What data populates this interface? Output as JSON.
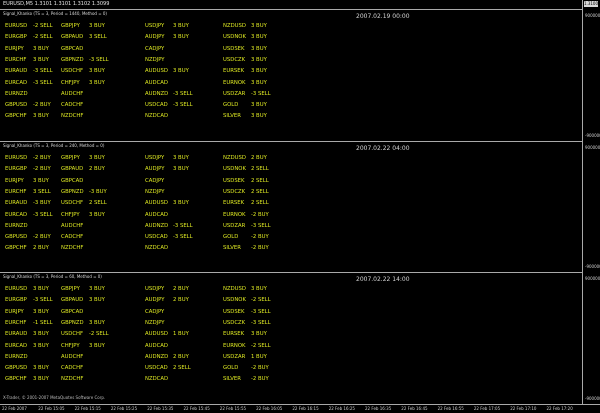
{
  "header": {
    "symbol_line": "EURUSD,M5  1.3101 1.3101 1.3102 1.3099",
    "price_box": "1.3100"
  },
  "panels": [
    {
      "title": "Signal_Khanko (TS = 3, Period = 1440, Method = 0)",
      "time": "2007.02.19 00:00",
      "scale_top": "90000000",
      "scale_bottom": "-90000000",
      "columns": [
        [
          {
            "sym": "EURUSD",
            "sig": "-2 SELL"
          },
          {
            "sym": "EURGBP",
            "sig": "-2 SELL"
          },
          {
            "sym": "EURJPY",
            "sig": "3 BUY"
          },
          {
            "sym": "EURCHF",
            "sig": "3 BUY"
          },
          {
            "sym": "EURAUD",
            "sig": "-3 SELL"
          },
          {
            "sym": "EURCAD",
            "sig": "-3 SELL"
          },
          {
            "sym": "EURNZD",
            "sig": ""
          },
          {
            "sym": "GBPUSD",
            "sig": "-2 BUY"
          },
          {
            "sym": "GBPCHF",
            "sig": "3 BUY"
          }
        ],
        [
          {
            "sym": "GBPJPY",
            "sig": "3 BUY"
          },
          {
            "sym": "GBPAUD",
            "sig": "3 SELL"
          },
          {
            "sym": "GBPCAD",
            "sig": ""
          },
          {
            "sym": "GBPNZD",
            "sig": "-3 SELL"
          },
          {
            "sym": "USDCHF",
            "sig": "3 BUY"
          },
          {
            "sym": "CHFJPY",
            "sig": "3 BUY"
          },
          {
            "sym": "AUDCHF",
            "sig": ""
          },
          {
            "sym": "CADCHF",
            "sig": ""
          },
          {
            "sym": "NZDCHF",
            "sig": ""
          }
        ],
        [
          {
            "sym": "USDJPY",
            "sig": "3 BUY"
          },
          {
            "sym": "AUDJPY",
            "sig": "3 BUY"
          },
          {
            "sym": "CADJPY",
            "sig": ""
          },
          {
            "sym": "NZDJPY",
            "sig": ""
          },
          {
            "sym": "AUDUSD",
            "sig": "3 BUY"
          },
          {
            "sym": "AUDCAD",
            "sig": ""
          },
          {
            "sym": "AUDNZD",
            "sig": "-3 SELL"
          },
          {
            "sym": "USDCAD",
            "sig": "-3 SELL"
          },
          {
            "sym": "NZDCAD",
            "sig": ""
          }
        ],
        [
          {
            "sym": "NZDUSD",
            "sig": "3 BUY"
          },
          {
            "sym": "USDNOK",
            "sig": "3 BUY"
          },
          {
            "sym": "USDSEK",
            "sig": "3 BUY"
          },
          {
            "sym": "USDCZK",
            "sig": "3 BUY"
          },
          {
            "sym": "EURSEK",
            "sig": "3 BUY"
          },
          {
            "sym": "EURNOK",
            "sig": "3 BUY"
          },
          {
            "sym": "USDZAR",
            "sig": "-3 SELL"
          },
          {
            "sym": "GOLD",
            "sig": "3 BUY"
          },
          {
            "sym": "SILVER",
            "sig": "3 BUY"
          }
        ]
      ]
    },
    {
      "title": "Signal_Khanko (TS = 3, Period = 240, Method = 0)",
      "time": "2007.02.22 04:00",
      "scale_top": "90000000",
      "scale_bottom": "-90000000",
      "columns": [
        [
          {
            "sym": "EURUSD",
            "sig": "-2 BUY"
          },
          {
            "sym": "EURGBP",
            "sig": "-2 BUY"
          },
          {
            "sym": "EURJPY",
            "sig": "3 BUY"
          },
          {
            "sym": "EURCHF",
            "sig": "3 SELL"
          },
          {
            "sym": "EURAUD",
            "sig": "-3 BUY"
          },
          {
            "sym": "EURCAD",
            "sig": "-3 SELL"
          },
          {
            "sym": "EURNZD",
            "sig": ""
          },
          {
            "sym": "GBPUSD",
            "sig": "-2 BUY"
          },
          {
            "sym": "GBPCHF",
            "sig": "2 BUY"
          }
        ],
        [
          {
            "sym": "GBPJPY",
            "sig": "3 BUY"
          },
          {
            "sym": "GBPAUD",
            "sig": "2 BUY"
          },
          {
            "sym": "GBPCAD",
            "sig": ""
          },
          {
            "sym": "GBPNZD",
            "sig": "-3 BUY"
          },
          {
            "sym": "USDCHF",
            "sig": "2 SELL"
          },
          {
            "sym": "CHFJPY",
            "sig": "3 BUY"
          },
          {
            "sym": "AUDCHF",
            "sig": ""
          },
          {
            "sym": "CADCHF",
            "sig": ""
          },
          {
            "sym": "NZDCHF",
            "sig": ""
          }
        ],
        [
          {
            "sym": "USDJPY",
            "sig": "3 BUY"
          },
          {
            "sym": "AUDJPY",
            "sig": "3 BUY"
          },
          {
            "sym": "CADJPY",
            "sig": ""
          },
          {
            "sym": "NZDJPY",
            "sig": ""
          },
          {
            "sym": "AUDUSD",
            "sig": "3 BUY"
          },
          {
            "sym": "AUDCAD",
            "sig": ""
          },
          {
            "sym": "AUDNZD",
            "sig": "-3 SELL"
          },
          {
            "sym": "USDCAD",
            "sig": "-3 SELL"
          },
          {
            "sym": "NZDCAD",
            "sig": ""
          }
        ],
        [
          {
            "sym": "NZDUSD",
            "sig": "2 BUY"
          },
          {
            "sym": "USDNOK",
            "sig": "2 SELL"
          },
          {
            "sym": "USDSEK",
            "sig": "2 SELL"
          },
          {
            "sym": "USDCZK",
            "sig": "2 SELL"
          },
          {
            "sym": "EURSEK",
            "sig": "2 SELL"
          },
          {
            "sym": "EURNOK",
            "sig": "-2 BUY"
          },
          {
            "sym": "USDZAR",
            "sig": "-3 SELL"
          },
          {
            "sym": "GOLD",
            "sig": "-2 BUY"
          },
          {
            "sym": "SILVER",
            "sig": "-2 BUY"
          }
        ]
      ]
    },
    {
      "title": "Signal_Khanko (TS = 3, Period = 60, Method = 0)",
      "time": "2007.02.22 14:00",
      "scale_top": "90000000",
      "scale_bottom": "-90000000",
      "columns": [
        [
          {
            "sym": "EURUSD",
            "sig": "3 BUY"
          },
          {
            "sym": "EURGBP",
            "sig": "-3 SELL"
          },
          {
            "sym": "EURJPY",
            "sig": "3 BUY"
          },
          {
            "sym": "EURCHF",
            "sig": "-1 SELL"
          },
          {
            "sym": "EURAUD",
            "sig": "3 BUY"
          },
          {
            "sym": "EURCAD",
            "sig": "3 BUY"
          },
          {
            "sym": "EURNZD",
            "sig": ""
          },
          {
            "sym": "GBPUSD",
            "sig": "3 BUY"
          },
          {
            "sym": "GBPCHF",
            "sig": "3 BUY"
          }
        ],
        [
          {
            "sym": "GBPJPY",
            "sig": "3 BUY"
          },
          {
            "sym": "GBPAUD",
            "sig": "3 BUY"
          },
          {
            "sym": "GBPCAD",
            "sig": ""
          },
          {
            "sym": "GBPNZD",
            "sig": "3 BUY"
          },
          {
            "sym": "USDCHF",
            "sig": "-2 SELL"
          },
          {
            "sym": "CHFJPY",
            "sig": "3 BUY"
          },
          {
            "sym": "AUDCHF",
            "sig": ""
          },
          {
            "sym": "CADCHF",
            "sig": ""
          },
          {
            "sym": "NZDCHF",
            "sig": ""
          }
        ],
        [
          {
            "sym": "USDJPY",
            "sig": "2 BUY"
          },
          {
            "sym": "AUDJPY",
            "sig": "2 BUY"
          },
          {
            "sym": "CADJPY",
            "sig": ""
          },
          {
            "sym": "NZDJPY",
            "sig": ""
          },
          {
            "sym": "AUDUSD",
            "sig": "1 BUY"
          },
          {
            "sym": "AUDCAD",
            "sig": ""
          },
          {
            "sym": "AUDNZD",
            "sig": "2 BUY"
          },
          {
            "sym": "USDCAD",
            "sig": "2 SELL"
          },
          {
            "sym": "NZDCAD",
            "sig": ""
          }
        ],
        [
          {
            "sym": "NZDUSD",
            "sig": "3 BUY"
          },
          {
            "sym": "USDNOK",
            "sig": "-2 SELL"
          },
          {
            "sym": "USDSEK",
            "sig": "-3 SELL"
          },
          {
            "sym": "USDCZK",
            "sig": "-3 SELL"
          },
          {
            "sym": "EURSEK",
            "sig": "3 BUY"
          },
          {
            "sym": "EURNOK",
            "sig": "-2 SELL"
          },
          {
            "sym": "USDZAR",
            "sig": "1 BUY"
          },
          {
            "sym": "GOLD",
            "sig": "-2 BUY"
          },
          {
            "sym": "SILVER",
            "sig": "-2 BUY"
          }
        ]
      ]
    }
  ],
  "copyright": "X-Trader, © 2001-2007 MetaQuotes Software Corp.",
  "time_axis": [
    "22 Feb 2007",
    "22 Feb 15:05",
    "22 Feb 15:15",
    "22 Feb 15:25",
    "22 Feb 15:35",
    "22 Feb 15:45",
    "22 Feb 15:55",
    "22 Feb 16:05",
    "22 Feb 16:15",
    "22 Feb 16:25",
    "22 Feb 16:35",
    "22 Feb 16:45",
    "22 Feb 16:55",
    "22 Feb 17:05",
    "22 Feb 17:10",
    "22 Feb 17:20"
  ],
  "colors": {
    "text_signal": "#e3ee23",
    "background": "#000000",
    "divider": "#a9a9a9"
  }
}
